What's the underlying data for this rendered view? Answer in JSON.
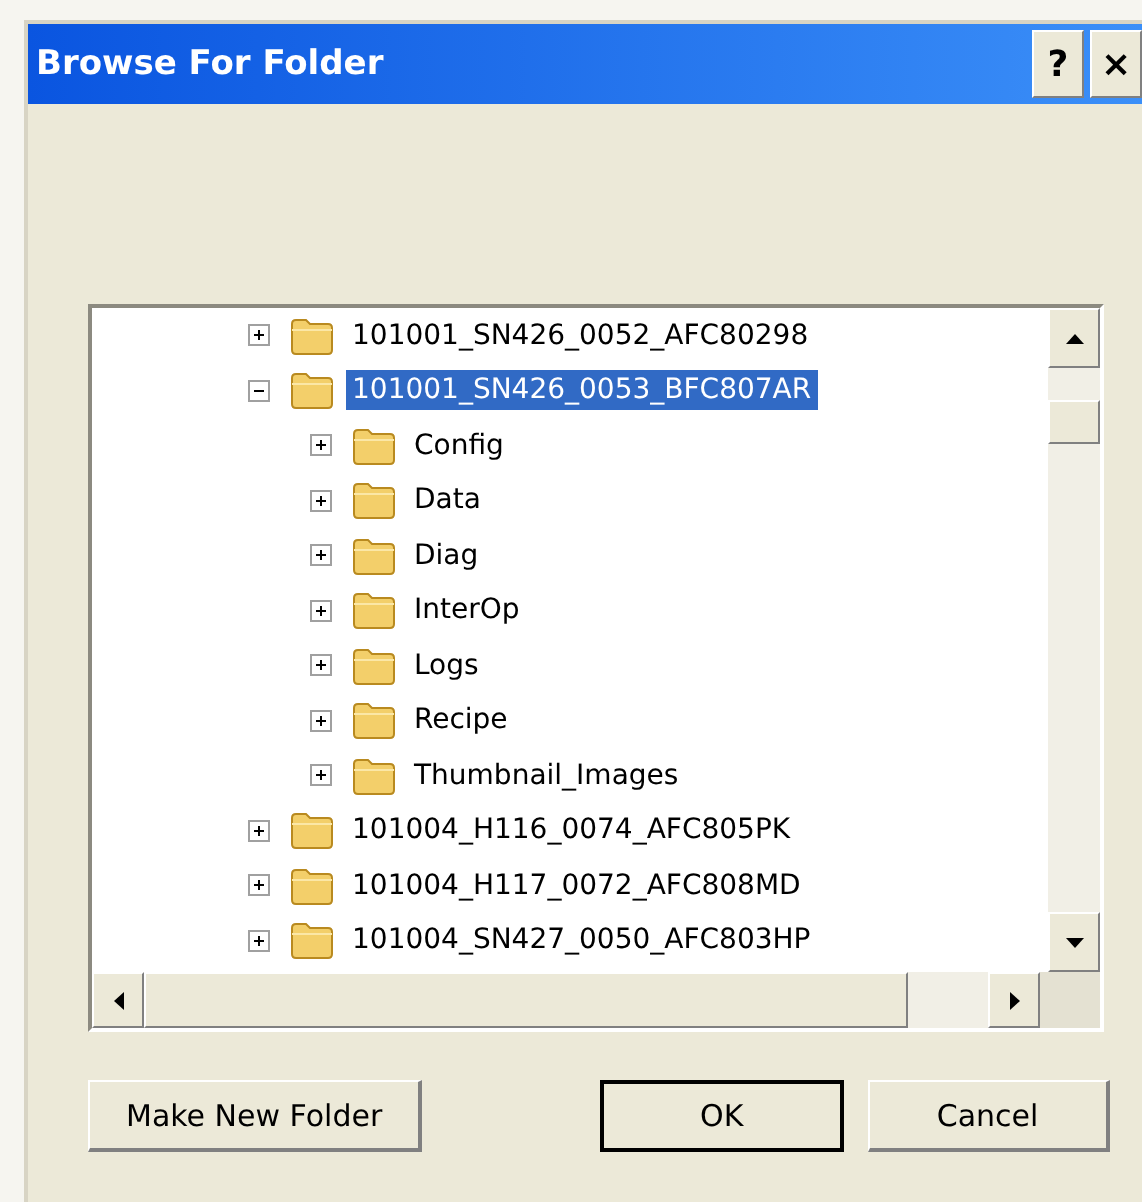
{
  "window": {
    "title": "Browse For Folder",
    "title_buttons": [
      "?",
      "×"
    ]
  },
  "tree": {
    "items": [
      {
        "label": "101001_SN426_0052_AFC80298",
        "expanded": false,
        "selected": false
      },
      {
        "label": "101001_SN426_0053_BFC807AR",
        "expanded": true,
        "selected": true,
        "children": [
          {
            "label": "Config",
            "expanded": false,
            "selected": false
          },
          {
            "label": "Data",
            "expanded": false,
            "selected": false
          },
          {
            "label": "Diag",
            "expanded": false,
            "selected": false
          },
          {
            "label": "InterOp",
            "expanded": false,
            "selected": false
          },
          {
            "label": "Logs",
            "expanded": false,
            "selected": false
          },
          {
            "label": "Recipe",
            "expanded": false,
            "selected": false
          },
          {
            "label": "Thumbnail_Images",
            "expanded": false,
            "selected": false
          }
        ]
      },
      {
        "label": "101004_H116_0074_AFC805PK",
        "expanded": false,
        "selected": false
      },
      {
        "label": "101004_H117_0072_AFC808MD",
        "expanded": false,
        "selected": false
      },
      {
        "label": "101004_SN427_0050_AFC803HP",
        "expanded": false,
        "selected": false
      }
    ]
  },
  "buttons": [
    {
      "label": "Make New Folder",
      "default": false
    },
    {
      "label": "OK",
      "default": true
    },
    {
      "label": "Cancel",
      "default": false
    }
  ]
}
